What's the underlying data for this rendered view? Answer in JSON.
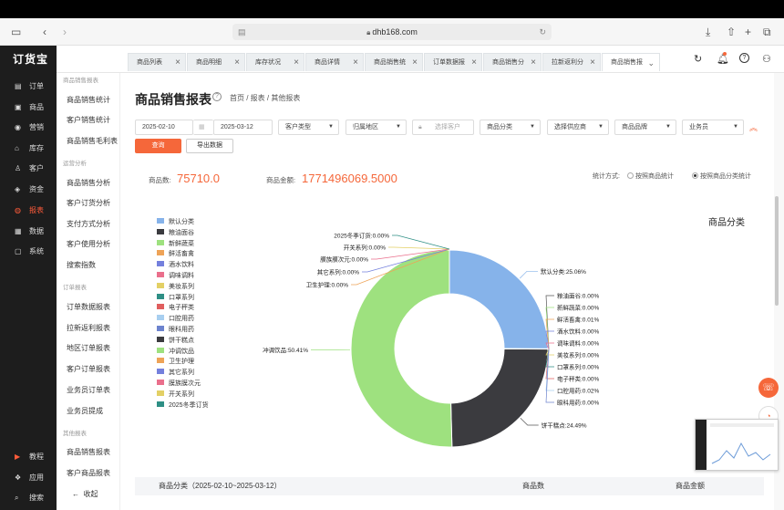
{
  "browser": {
    "url": "dhb168.com"
  },
  "app": {
    "logo": "订货宝"
  },
  "tabs": [
    {
      "label": "商品列表"
    },
    {
      "label": "商品明细"
    },
    {
      "label": "库存状况"
    },
    {
      "label": "商品详情"
    },
    {
      "label": "商品销售统"
    },
    {
      "label": "订单数据报"
    },
    {
      "label": "商品销售分"
    },
    {
      "label": "拉新返利分"
    },
    {
      "label": "商品销售报"
    }
  ],
  "nav": {
    "items": [
      {
        "label": "订单",
        "icon": "order-icon"
      },
      {
        "label": "商品",
        "icon": "goods-icon"
      },
      {
        "label": "营销",
        "icon": "marketing-icon"
      },
      {
        "label": "库存",
        "icon": "inventory-icon"
      },
      {
        "label": "客户",
        "icon": "customer-icon"
      },
      {
        "label": "资金",
        "icon": "funds-icon"
      },
      {
        "label": "报表",
        "icon": "report-icon"
      },
      {
        "label": "数据",
        "icon": "data-icon"
      },
      {
        "label": "系统",
        "icon": "system-icon"
      }
    ],
    "bottom": [
      {
        "label": "教程",
        "icon": "tutorial-icon"
      },
      {
        "label": "应用",
        "icon": "apps-icon"
      },
      {
        "label": "搜索",
        "icon": "search-icon"
      }
    ],
    "active_color": "#ff5b3a"
  },
  "subnav": {
    "heads": [
      "商品销售报表",
      "运营分析",
      "订单报表",
      "其他报表"
    ],
    "items": [
      "商品销售统计",
      "客户销售统计",
      "商品销售毛利表",
      "商品销售分析",
      "客户订货分析",
      "支付方式分析",
      "客户使用分析",
      "搜索指数",
      "订单数据报表",
      "拉新返利报表",
      "地区订单报表",
      "客户订单报表",
      "业务员订单表",
      "业务员提成",
      "商品销售报表",
      "客户商品报表"
    ],
    "collapse": "收起"
  },
  "page": {
    "title": "商品销售报表",
    "breadcrumb": "首页 / 报表 / 其他报表"
  },
  "filters": {
    "date_start": "2025-02-10",
    "date_end": "2025-03-12",
    "customer_type": "客户类型",
    "region": "归属地区",
    "customer_placeholder": "选择客户",
    "category": "商品分类",
    "supplier": "选择供应商",
    "brand": "商品品牌",
    "salesman": "业务员",
    "query": "查询",
    "export": "导出数据"
  },
  "stats": {
    "count_label": "商品数:",
    "count_value": "75710.0",
    "amount_label": "商品金额:",
    "amount_value": "1771496069.5000",
    "mode_label": "统计方式:",
    "mode_opt1": "按照商品统计",
    "mode_opt2": "按照商品分类统计"
  },
  "chart_data": {
    "type": "pie",
    "title": "商品分类",
    "donut": true,
    "slices": [
      {
        "name": "默认分类",
        "value": 25.06,
        "color": "#86b3ea",
        "label": "默认分类:25.06%"
      },
      {
        "name": "粮油面谷",
        "value": 0.0,
        "color": "#3b3b3f",
        "label": "粮油面谷:0.00%"
      },
      {
        "name": "新鲜蔬菜",
        "value": 0.0,
        "color": "#9ee17f",
        "label": "新鲜蔬菜:0.00%"
      },
      {
        "name": "鲜活畜禽",
        "value": 0.01,
        "color": "#eea357",
        "label": "鲜活畜禽:0.01%"
      },
      {
        "name": "酒水饮料",
        "value": 0.0,
        "color": "#7480dd",
        "label": "酒水饮料:0.00%"
      },
      {
        "name": "调味调料",
        "value": 0.0,
        "color": "#ea6f8c",
        "label": "调味调料:0.00%"
      },
      {
        "name": "美妆系列",
        "value": 0.0,
        "color": "#e3d065",
        "label": "美妆系列:0.00%"
      },
      {
        "name": "口罩系列",
        "value": 0.0,
        "color": "#2e8f85",
        "label": "口罩系列:0.00%"
      },
      {
        "name": "电子秤类",
        "value": 0.0,
        "color": "#e05e5e",
        "label": "电子秤类:0.00%"
      },
      {
        "name": "口腔用药",
        "value": 0.02,
        "color": "#a8cff0",
        "label": "口腔用药:0.02%"
      },
      {
        "name": "眼科用药",
        "value": 0.0,
        "color": "#6c83ce",
        "label": "眼科用药:0.00%"
      },
      {
        "name": "饼干糕点",
        "value": 24.49,
        "color": "#3b3b3f",
        "label": "饼干糕点:24.49%"
      },
      {
        "name": "冲调饮品",
        "value": 50.41,
        "color": "#9ee17f",
        "label": "冲调饮品:50.41%"
      },
      {
        "name": "卫生护理",
        "value": 0.0,
        "color": "#eea357",
        "label": "卫生护理:0.00%"
      },
      {
        "name": "其它系列",
        "value": 0.0,
        "color": "#7480dd",
        "label": "其它系列:0.00%"
      },
      {
        "name": "膜族膜次元",
        "value": 0.0,
        "color": "#ea6f8c",
        "label": "膜族膜次元:0.00%"
      },
      {
        "name": "开关系列",
        "value": 0.0,
        "color": "#e3d065",
        "label": "开关系列:0.00%"
      },
      {
        "name": "2025冬季订货",
        "value": 0.0,
        "color": "#2e8f85",
        "label": "2025冬季订货:0.00%"
      }
    ]
  },
  "table": {
    "col1": "商品分类（2025-02-10~2025-03-12）",
    "col2": "商品数",
    "col3": "商品金额"
  },
  "accent": "#f5673a"
}
